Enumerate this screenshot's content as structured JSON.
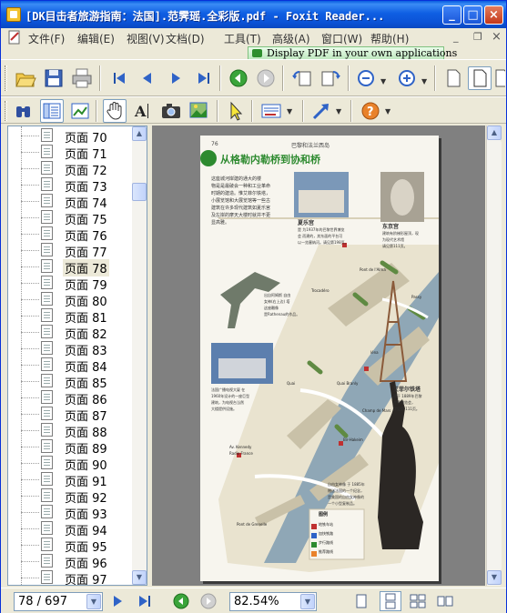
{
  "window": {
    "title": "[DK目击者旅游指南：法国].范霁瑶.全彩版.pdf - Foxit Reader...",
    "minimize_glyph": "_",
    "maximize_glyph": "□",
    "close_glyph": "×"
  },
  "menu": {
    "items": [
      "文件(F)",
      "编辑(E)",
      "视图(V)",
      "文档(D)",
      "工具(T)",
      "高级(A)",
      "窗口(W)",
      "帮助(H)"
    ]
  },
  "ad_banner": {
    "text": "Display PDF in your own applications"
  },
  "sidebar": {
    "pages": [
      "页面 70",
      "页面 71",
      "页面 72",
      "页面 73",
      "页面 74",
      "页面 75",
      "页面 76",
      "页面 77",
      "页面 78",
      "页面 79",
      "页面 80",
      "页面 81",
      "页面 82",
      "页面 83",
      "页面 84",
      "页面 85",
      "页面 86",
      "页面 87",
      "页面 88",
      "页面 89",
      "页面 90",
      "页面 91",
      "页面 92",
      "页面 93",
      "页面 94",
      "页面 95",
      "页面 96",
      "页面 97"
    ],
    "selected": "页面 78"
  },
  "document": {
    "page_number_label": "76",
    "running_header": "巴黎和法兰西岛",
    "heading": "从格勒内勒桥到协和桥",
    "intro_lines": [
      "这座城河岸建的通大的楼",
      "物是是最破会一种和工业革命",
      "时期的建造。惟艾菲尔铁塔，",
      "小展览馆和大展览馆等一些古",
      "建筑在许多现代建筑如夏乐宫",
      "及左岸的摩天大楼时就并不更",
      "显高雅。"
    ],
    "photo1_caption_title": "夏乐宫",
    "photo1_caption_lines": [
      "是 为1937年的巴黎世界博览",
      "会 而建的，其东面的平台可",
      "以一览塞纳河。请见第198页。"
    ],
    "photo2_caption_title": "东京宫",
    "photo2_caption_lines": [
      "建筑有阶梯形屋顶，现",
      "为现代艺术馆",
      "请见第111页。"
    ],
    "statue_caption_lines": [
      "出自阿姆斯 自由",
      "女神(右上边) 塔",
      "这座雕像",
      "是Rathenau的作品。"
    ],
    "building_caption_lines": [
      "法国广播电视大厦 在",
      "1960年设计的一座巨型",
      "建筑，为电视台当然",
      "大楼提供设施。"
    ],
    "tower_caption_title": "艾菲尔铁塔",
    "tower_caption_lines": [
      "建于 1889年巴黎",
      "世界博览会，",
      "详见第 111页。"
    ],
    "liberty_caption_lines": [
      "自由女神像 于 1885年",
      "赠送法国的一个纪念，",
      "是美国的自由女神像的",
      "一个小型复制品。"
    ],
    "map_labels": [
      "Trocadéro",
      "Iéna",
      "Passy",
      "Bir-Hakeim",
      "Pont de l'Alma",
      "Av. Kennedy",
      "Radio France",
      "Pont de Grenelle",
      "Quai",
      "Quai Branly",
      "Champ de Mars"
    ],
    "legend_title": "图例",
    "legend_items": [
      "地铁车站",
      "加快铁路",
      "步行路线",
      "推荐路线"
    ]
  },
  "statusbar": {
    "page_indicator": "78 / 697",
    "zoom": "82.54%",
    "dropdown_glyph": "▼"
  },
  "icons": {
    "toolbar1": [
      "open-icon",
      "save-icon",
      "print-icon",
      "first-page-icon",
      "previous-page-icon",
      "next-page-icon",
      "last-page-icon",
      "go-back-icon",
      "go-forward-icon",
      "rotate-left-icon",
      "rotate-right-icon",
      "zoom-out-icon",
      "zoom-in-icon",
      "single-page-icon",
      "fit-page-icon",
      "fit-width-icon"
    ],
    "toolbar2": [
      "find-icon",
      "bookmark-panel-icon",
      "thumbnail-icon",
      "hand-tool-icon",
      "text-select-icon",
      "snapshot-icon",
      "image-select-icon",
      "select-tool-icon",
      "annotation-icon",
      "arrow-tool-icon",
      "help-icon"
    ]
  },
  "colors": {
    "title_bar": "#0b52d6",
    "heading_green": "#2d8a2f",
    "river": "#8fa7b6",
    "ad_green": "#bfe8bf"
  }
}
